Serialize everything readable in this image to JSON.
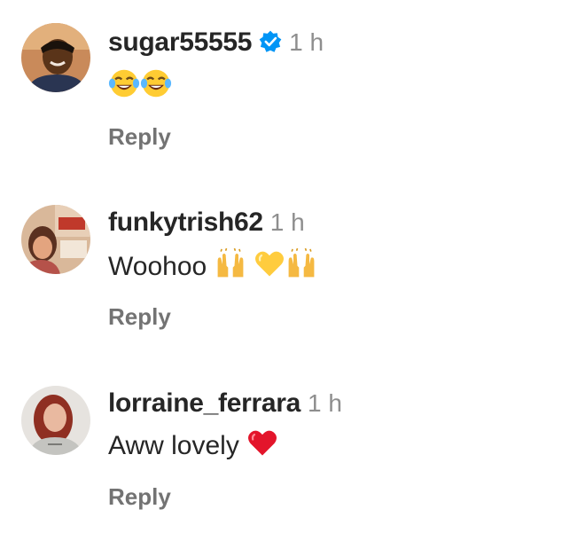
{
  "comments": [
    {
      "username": "sugar55555",
      "verified": true,
      "time": "1 h",
      "text": "",
      "emojis": [
        "face-with-tears-of-joy-icon",
        "face-with-tears-of-joy-icon"
      ],
      "reply_label": "Reply"
    },
    {
      "username": "funkytrish62",
      "verified": false,
      "time": "1 h",
      "text": "Woohoo",
      "emojis": [
        "raising-hands-icon",
        "yellow-heart-icon",
        "raising-hands-icon"
      ],
      "reply_label": "Reply"
    },
    {
      "username": "lorraine_ferrara",
      "verified": false,
      "time": "1 h",
      "text": "Aww lovely",
      "emojis": [
        "red-heart-icon"
      ],
      "reply_label": "Reply"
    }
  ],
  "colors": {
    "username": "#262626",
    "time": "#8e8e8e",
    "reply": "#737373",
    "verified_badge": "#0095f6"
  }
}
